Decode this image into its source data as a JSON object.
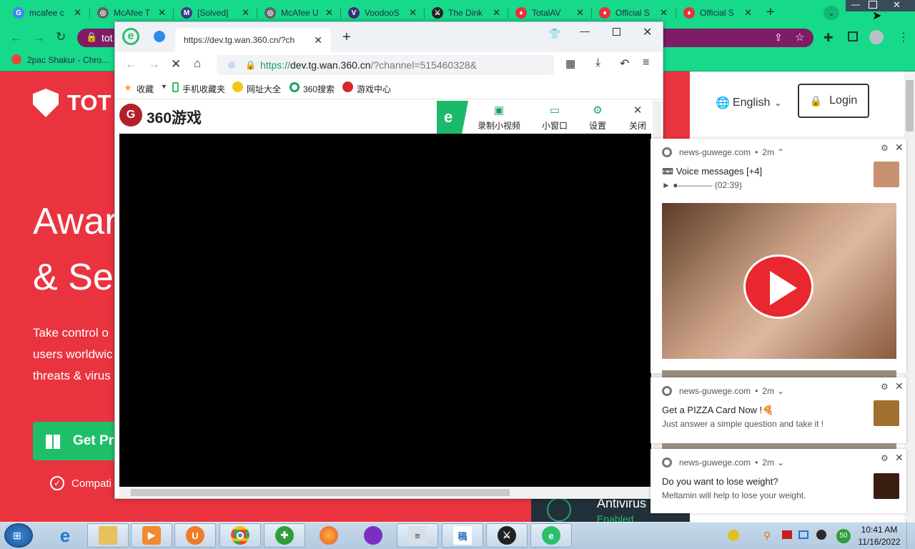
{
  "chrome": {
    "tabs": [
      {
        "title": "mcafee c",
        "icon": "google-icon",
        "color": "#4285f4",
        "glyph": "G"
      },
      {
        "title": "McAfee T",
        "icon": "globe-icon",
        "color": "#5f6368",
        "glyph": "◎"
      },
      {
        "title": "[Solved] ",
        "icon": "mail-icon",
        "color": "#3a3a8a",
        "glyph": "M"
      },
      {
        "title": "McAfee U",
        "icon": "globe-icon",
        "color": "#5f6368",
        "glyph": "◎"
      },
      {
        "title": "VoodooS",
        "icon": "shield-icon",
        "color": "#33337a",
        "glyph": "V"
      },
      {
        "title": "The Dink",
        "icon": "sword-icon",
        "color": "#222222",
        "glyph": "⚔"
      },
      {
        "title": "TotalAV",
        "icon": "totalav-shield-icon",
        "color": "#e8303a",
        "glyph": "♦"
      },
      {
        "title": "Official S",
        "icon": "totalav-shield-icon",
        "color": "#e8303a",
        "glyph": "♦"
      },
      {
        "title": "Official S",
        "icon": "totalav-shield-icon",
        "color": "#e8303a",
        "glyph": "♦"
      }
    ],
    "address_text": "tot",
    "bookmark": "2pac Shakur - Chro..."
  },
  "site": {
    "brand": "TOT",
    "headline1": "Awar",
    "headline2": "& Sec",
    "para1": "Take control o",
    "para2": "users worldwic",
    "para3": "threats & virus",
    "cta": "Get Pr",
    "compat": "Compati",
    "language": "English",
    "login": "Login",
    "antivirus": "Antivirus",
    "enabled": "Enabled"
  },
  "browser360": {
    "tab_url": "https://dev.tg.wan.360.cn/?ch",
    "url_https": "https://",
    "url_host": "dev.tg.wan.360.cn",
    "url_rest": "/?channel=515460328&",
    "bookmarks": [
      "收藏",
      "手机收藏夹",
      "网址大全",
      "360搜索",
      "游戏中心"
    ],
    "brand": "360游戏",
    "toolbar": [
      "录制小视频",
      "小窗口",
      "设置",
      "关闭"
    ]
  },
  "notifications": [
    {
      "source": "news-guwege.com",
      "time": "2m",
      "title": "📼 Voice messages [+4]",
      "body": "► ●———— (02:39)"
    },
    {
      "source": "news-guwege.com",
      "time": "2m",
      "title": "Get a PIZZA Card Now !🍕",
      "body": "Just answer a simple question and take it !"
    },
    {
      "source": "news-guwege.com",
      "time": "2m",
      "title": "Do you want to lose weight?",
      "body": "Meltamin will help to lose your weight."
    }
  ],
  "taskbar": {
    "time": "10:41 AM",
    "date": "11/16/2022",
    "badge": "50"
  }
}
